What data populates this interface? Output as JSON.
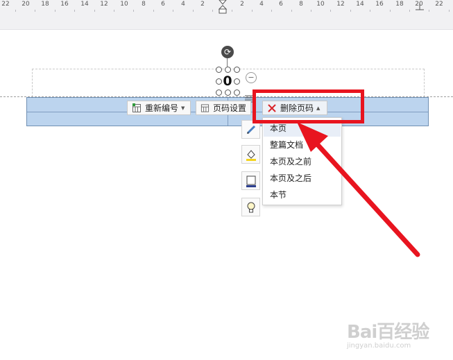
{
  "ruler": {
    "numbers": [
      "22",
      "20",
      "18",
      "16",
      "14",
      "12",
      "10",
      "8",
      "6",
      "4",
      "2",
      "2",
      "4",
      "6",
      "8",
      "10",
      "12",
      "14",
      "16",
      "18",
      "20",
      "22"
    ]
  },
  "page_number": {
    "value": "0",
    "rotate_glyph": "⟳",
    "minus_glyph": "−"
  },
  "toolbar": {
    "renumber_label": "重新编号",
    "page_settings_label": "页码设置",
    "delete_label": "删除页码"
  },
  "dropdown": {
    "items": [
      {
        "label": "本页"
      },
      {
        "label": "整篇文档"
      },
      {
        "label": "本页及之前"
      },
      {
        "label": "本页及之后"
      },
      {
        "label": "本节"
      }
    ]
  },
  "icons": {
    "side": [
      "pen-icon",
      "fill-color-icon",
      "border-icon",
      "lightbulb-icon"
    ],
    "delete": "red-x-icon"
  },
  "colors": {
    "annotation": "#e8141f",
    "footer_band": "#bcd4ee",
    "delete_x": "#d9262b"
  },
  "watermark": {
    "logo": "Bai百经验",
    "url": "jingyan.baidu.com"
  }
}
